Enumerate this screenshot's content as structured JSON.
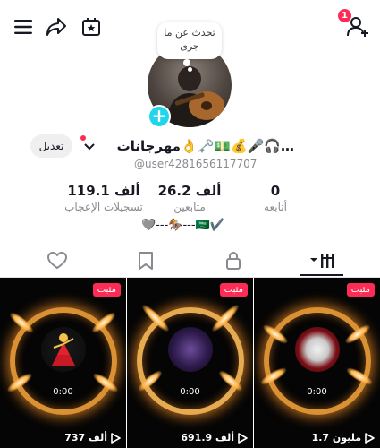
{
  "header": {
    "notification_count": "1"
  },
  "profile": {
    "status_bubble": "تحدث عن ما جرى",
    "edit_label": "تعديل",
    "username": "مهرجانات👌🗝️💵💰🎤🎧…",
    "handle": "@user4281656117707",
    "bio": "🩶---🏇---🇸🇦✔️"
  },
  "stats": [
    {
      "value": "0",
      "label": "أتابعه"
    },
    {
      "value": "26.2 ألف",
      "label": "متابعين"
    },
    {
      "value": "119.1 ألف",
      "label": "تسجيلات الإعجاب"
    }
  ],
  "videos": [
    {
      "pinned": "مثبت",
      "time": "0:00",
      "views": "1.7 مليون"
    },
    {
      "pinned": "مثبت",
      "time": "0:00",
      "views": "691.9 ألف"
    },
    {
      "pinned": "مثبت",
      "time": "0:00",
      "views": "737 ألف"
    }
  ],
  "colors": {
    "accent": "#fe2c55",
    "add_button": "#20d5ec",
    "glow": "#ffb347"
  }
}
